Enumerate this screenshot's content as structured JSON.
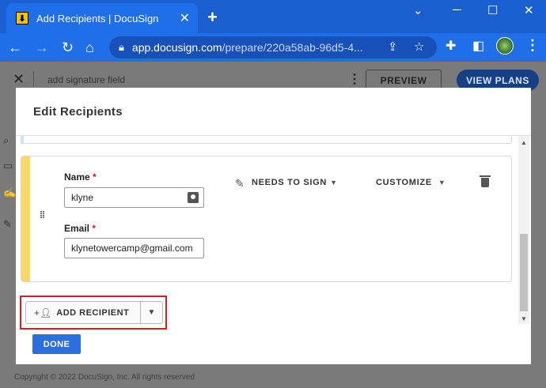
{
  "browser": {
    "tab_title": "Add Recipients | DocuSign",
    "tab_favicon": "⬇",
    "new_tab_label": "+",
    "url_host": "app.docusign.com",
    "url_path": "/prepare/220a58ab-96d5-4..."
  },
  "page": {
    "hint_text": "add signature field",
    "preview_label": "PREVIEW",
    "view_plans_label": "VIEW PLANS",
    "copyright": "Copyright © 2022 DocuSign, Inc. All rights reserved"
  },
  "modal": {
    "title": "Edit Recipients",
    "recipient": {
      "name_label": "Name",
      "name_value": "klyne",
      "email_label": "Email",
      "email_value": "klynetowercamp@gmail.com",
      "required_mark": "*",
      "action_label": "NEEDS TO SIGN",
      "customize_label": "CUSTOMIZE"
    },
    "add_recipient_label": "ADD RECIPIENT",
    "done_label": "DONE"
  },
  "colors": {
    "chrome_blue": "#1f6fe8",
    "recipient_accent": "#fdd867",
    "done_button": "#2b6fe0",
    "highlight_border": "#e01b1b"
  }
}
